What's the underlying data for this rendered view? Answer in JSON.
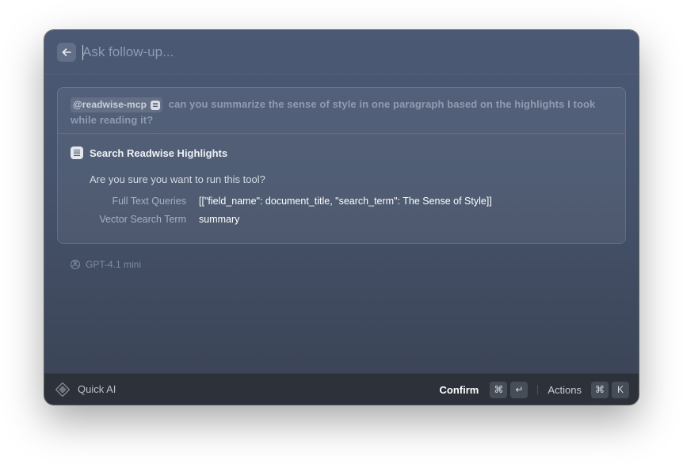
{
  "header": {
    "placeholder": "Ask follow-up..."
  },
  "prompt": {
    "mention": "@readwise-mcp",
    "text": "can you summarize the sense of style in one paragraph based on the highlights I took while reading it?"
  },
  "tool": {
    "title": "Search Readwise Highlights",
    "confirm_question": "Are you sure you want to run this tool?",
    "params": [
      {
        "label": "Full Text Queries",
        "value": "[[\"field_name\": document_title, \"search_term\": The Sense of Style]]"
      },
      {
        "label": "Vector Search Term",
        "value": "summary"
      }
    ]
  },
  "model": {
    "name": "GPT-4.1 mini"
  },
  "footer": {
    "brand": "Quick AI",
    "confirm_label": "Confirm",
    "confirm_keys": [
      "⌘",
      "↵"
    ],
    "actions_label": "Actions",
    "actions_keys": [
      "⌘",
      "K"
    ]
  },
  "colors": {
    "window_top": "#4b5975",
    "window_bottom": "#3a4354",
    "footer_bg": "#2d323a",
    "key_bg": "#474d57"
  }
}
